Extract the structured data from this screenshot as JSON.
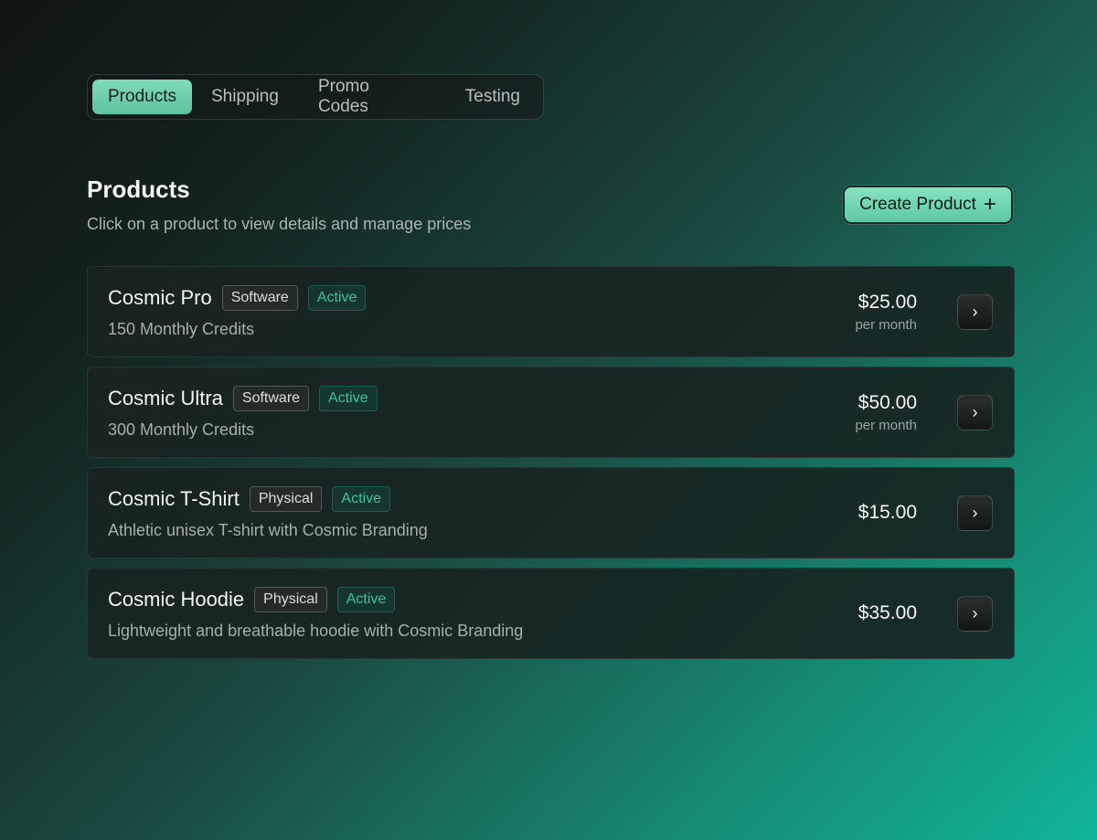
{
  "tabs": [
    {
      "label": "Products",
      "active": true
    },
    {
      "label": "Shipping",
      "active": false
    },
    {
      "label": "Promo Codes",
      "active": false
    },
    {
      "label": "Testing",
      "active": false
    }
  ],
  "header": {
    "title": "Products",
    "subtitle": "Click on a product to view details and manage prices",
    "create_label": "Create Product",
    "create_icon": "plus-icon"
  },
  "products": [
    {
      "name": "Cosmic Pro",
      "type": "Software",
      "status": "Active",
      "description": "150 Monthly Credits",
      "price": "$25.00",
      "period": "per month"
    },
    {
      "name": "Cosmic Ultra",
      "type": "Software",
      "status": "Active",
      "description": "300 Monthly Credits",
      "price": "$50.00",
      "period": "per month"
    },
    {
      "name": "Cosmic T-Shirt",
      "type": "Physical",
      "status": "Active",
      "description": "Athletic unisex T-shirt with Cosmic Branding",
      "price": "$15.00",
      "period": ""
    },
    {
      "name": "Cosmic Hoodie",
      "type": "Physical",
      "status": "Active",
      "description": "Lightweight and breathable hoodie with Cosmic Branding",
      "price": "$35.00",
      "period": ""
    }
  ],
  "colors": {
    "accent": "#6fd3af",
    "status_text": "#35c59e",
    "card_bg": "#182422"
  }
}
